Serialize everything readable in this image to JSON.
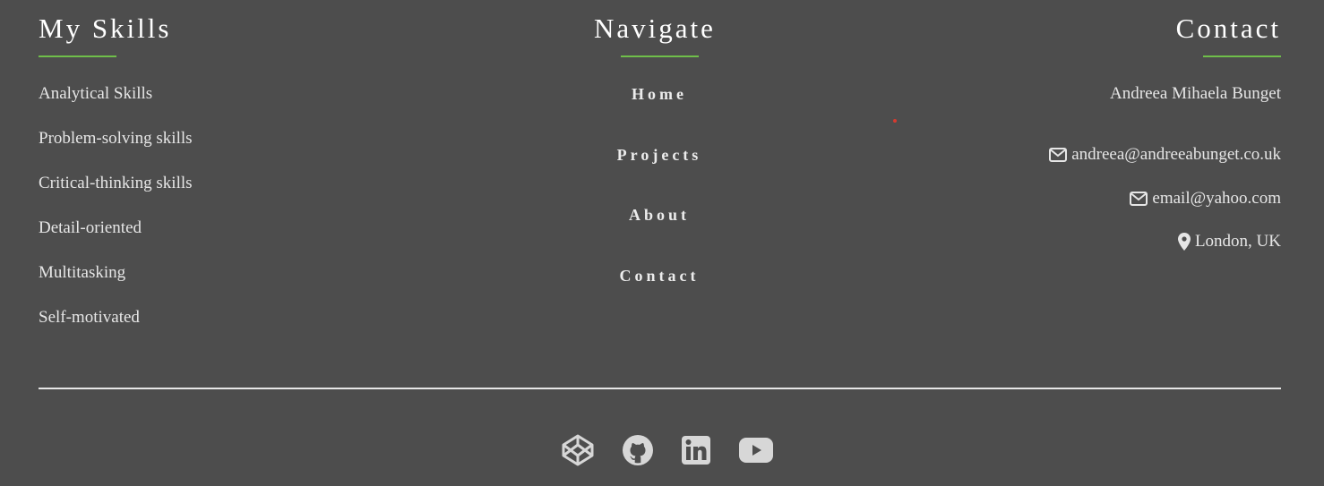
{
  "skills": {
    "heading": "My Skills",
    "items": [
      "Analytical Skills",
      "Problem-solving skills",
      "Critical-thinking skills",
      "Detail-oriented",
      "Multitasking",
      "Self-motivated"
    ]
  },
  "navigate": {
    "heading": "Navigate",
    "links": [
      "Home",
      "Projects",
      "About",
      "Contact"
    ]
  },
  "contact": {
    "heading": "Contact",
    "name": "Andreea Mihaela Bunget",
    "email_primary": "andreea@andreeabunget.co.uk",
    "email_secondary": "email@yahoo.com",
    "location": "London, UK",
    "icons": {
      "email": "envelope-icon",
      "location": "map-marker-icon"
    }
  },
  "social": {
    "icons": [
      "codepen-icon",
      "github-icon",
      "linkedin-icon",
      "youtube-icon"
    ]
  },
  "colors": {
    "background": "#4d4d4d",
    "accent": "#6fbf4a",
    "text": "#e6e6e6",
    "heading": "#ffffff"
  }
}
